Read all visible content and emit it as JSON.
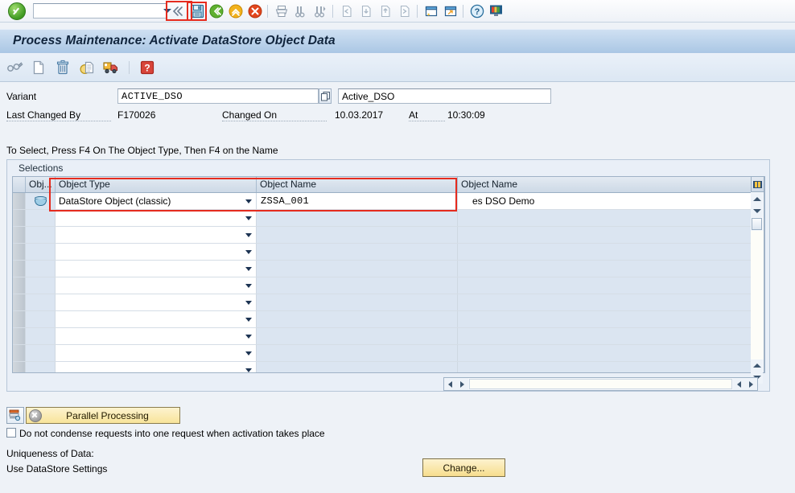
{
  "system_toolbar": {
    "ok_button": "ok-check-button",
    "command_value": "",
    "command_placeholder": "",
    "icons": [
      "back-arrow-icon",
      "save-icon",
      "back-green-icon",
      "exit-yellow-icon",
      "cancel-red-icon",
      "print-icon",
      "find-icon",
      "find-next-icon",
      "first-page-icon",
      "previous-page-icon",
      "next-page-icon",
      "last-page-icon",
      "create-session-icon",
      "create-shortcut-icon",
      "help-icon",
      "customize-layout-icon"
    ]
  },
  "title": "Process Maintenance: Activate DataStore Object Data",
  "app_toolbar": {
    "icons": [
      "display-change-icon",
      "create-variant-icon",
      "delete-variant-icon",
      "copy-variant-icon",
      "transport-variant-icon",
      "information-icon"
    ]
  },
  "variant": {
    "label": "Variant",
    "name_value": "ACTIVE_DSO",
    "description_value": "Active_DSO",
    "matchcode_icon": "multiple-selection-icon",
    "last_changed_by_label": "Last Changed By",
    "last_changed_by_value": "F170026",
    "changed_on_label": "Changed On",
    "changed_on_value": "10.03.2017",
    "at_label": "At",
    "at_value": "10:30:09"
  },
  "hint": "To Select, Press F4 On The Object Type, Then F4 on the Name",
  "selections": {
    "group_title": "Selections",
    "columns": [
      "Obj...",
      "Object Type",
      "Object Name",
      "Object Name"
    ],
    "column_config_icon": "table-settings-icon",
    "rows": [
      {
        "icon": "datastore-object-icon",
        "object_type": "DataStore Object (classic)",
        "object_name": "ZSSA_001",
        "object_description": "es DSO Demo",
        "filled": true
      },
      {
        "icon": "",
        "object_type": "",
        "object_name": "",
        "object_description": "",
        "filled": false
      },
      {
        "icon": "",
        "object_type": "",
        "object_name": "",
        "object_description": "",
        "filled": false
      },
      {
        "icon": "",
        "object_type": "",
        "object_name": "",
        "object_description": "",
        "filled": false
      },
      {
        "icon": "",
        "object_type": "",
        "object_name": "",
        "object_description": "",
        "filled": false
      },
      {
        "icon": "",
        "object_type": "",
        "object_name": "",
        "object_description": "",
        "filled": false
      },
      {
        "icon": "",
        "object_type": "",
        "object_name": "",
        "object_description": "",
        "filled": false
      },
      {
        "icon": "",
        "object_type": "",
        "object_name": "",
        "object_description": "",
        "filled": false
      },
      {
        "icon": "",
        "object_type": "",
        "object_name": "",
        "object_description": "",
        "filled": false
      },
      {
        "icon": "",
        "object_type": "",
        "object_name": "",
        "object_description": "",
        "filled": false
      },
      {
        "icon": "",
        "object_type": "",
        "object_name": "",
        "object_description": "",
        "filled": false
      }
    ]
  },
  "footer": {
    "parallel_processing_icon": "parallel-processing-settings-icon",
    "parallel_processing_label": "Parallel Processing",
    "condense_checkbox_label": "Do not condense requests into one request when activation takes place",
    "condense_checked": false,
    "uniqueness_label": "Uniqueness of Data:",
    "uniqueness_value": "Use DataStore Settings",
    "change_button_label": "Change..."
  },
  "annotations": {
    "save_icon_highlight": "red-box-save-icon",
    "selection_row_highlight": "red-box-object-type-and-name"
  },
  "colors": {
    "accent_red": "#e52b1e",
    "title_bar": "#a9c6e4",
    "button_yellow": "#f6dd8d"
  }
}
